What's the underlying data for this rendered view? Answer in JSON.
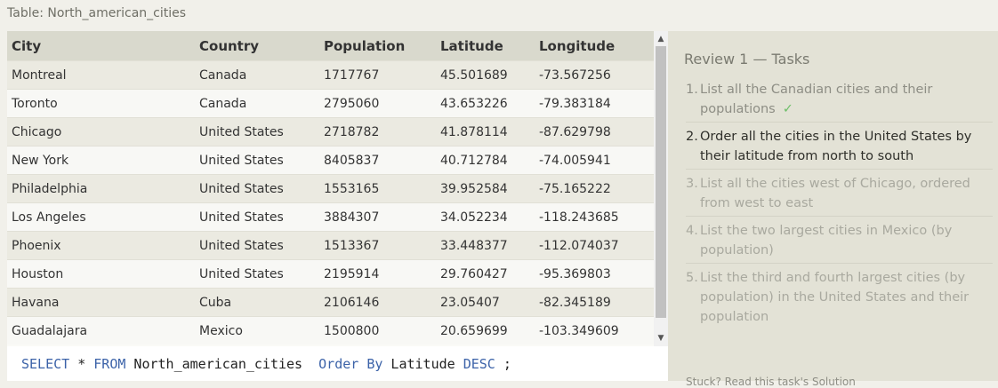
{
  "table_title": "Table: North_american_cities",
  "table": {
    "columns": [
      "City",
      "Country",
      "Population",
      "Latitude",
      "Longitude"
    ],
    "rows": [
      [
        "Montreal",
        "Canada",
        "1717767",
        "45.501689",
        "-73.567256"
      ],
      [
        "Toronto",
        "Canada",
        "2795060",
        "43.653226",
        "-79.383184"
      ],
      [
        "Chicago",
        "United States",
        "2718782",
        "41.878114",
        "-87.629798"
      ],
      [
        "New York",
        "United States",
        "8405837",
        "40.712784",
        "-74.005941"
      ],
      [
        "Philadelphia",
        "United States",
        "1553165",
        "39.952584",
        "-75.165222"
      ],
      [
        "Los Angeles",
        "United States",
        "3884307",
        "34.052234",
        "-118.243685"
      ],
      [
        "Phoenix",
        "United States",
        "1513367",
        "33.448377",
        "-112.074037"
      ],
      [
        "Houston",
        "United States",
        "2195914",
        "29.760427",
        "-95.369803"
      ],
      [
        "Havana",
        "Cuba",
        "2106146",
        "23.05407",
        "-82.345189"
      ],
      [
        "Guadalajara",
        "Mexico",
        "1500800",
        "20.659699",
        "-103.349609"
      ]
    ]
  },
  "scrollbar": {
    "up_arrow": "▲",
    "down_arrow": "▼"
  },
  "sql": {
    "tokens": [
      {
        "text": "SELECT",
        "kind": "kw"
      },
      {
        "text": " * ",
        "kind": "id"
      },
      {
        "text": "FROM",
        "kind": "kw"
      },
      {
        "text": " North_american_cities  ",
        "kind": "id"
      },
      {
        "text": "Order By",
        "kind": "kw"
      },
      {
        "text": " Latitude ",
        "kind": "id"
      },
      {
        "text": "DESC",
        "kind": "kw"
      },
      {
        "text": " ;",
        "kind": "id"
      }
    ]
  },
  "tasks": {
    "title": "Review 1 — Tasks",
    "items": [
      {
        "num": "1.",
        "text": "List all the Canadian cities and their populations",
        "state": "done",
        "check": "✓"
      },
      {
        "num": "2.",
        "text": "Order all the cities in the United States by their latitude from north to south",
        "state": "active"
      },
      {
        "num": "3.",
        "text": "List all the cities west of Chicago, ordered from west to east",
        "state": "future"
      },
      {
        "num": "4.",
        "text": "List the two largest cities in Mexico (by population)",
        "state": "future"
      },
      {
        "num": "5.",
        "text": "List the third and fourth largest cities (by population) in the United States and their population",
        "state": "future"
      }
    ],
    "footer": "Stuck? Read this task's Solution"
  },
  "colors": {
    "header_bg": "#d9d9cd",
    "row_odd": "#ebeae1",
    "row_even": "#f8f8f5",
    "keyword": "#3b62a8",
    "check": "#6fbf6a",
    "panel_bg": "#e3e2d6"
  }
}
